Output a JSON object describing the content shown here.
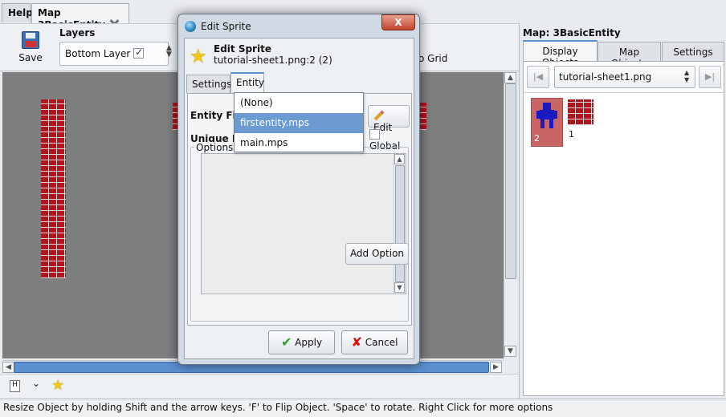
{
  "top_tabs": [
    {
      "label": "Help"
    },
    {
      "label": "Map 3BasicEntity"
    }
  ],
  "toolbar": {
    "save_label": "Save",
    "layers_group_label": "Layers",
    "layer_name": "Bottom Layer",
    "layer_visible": true,
    "snap_label_fragment": "o Grid"
  },
  "right_panel": {
    "title": "Map: 3BasicEntity",
    "tabs": [
      {
        "label": "Display Objects",
        "active": true
      },
      {
        "label": "Map Objects",
        "active": false
      },
      {
        "label": "Settings",
        "active": false
      }
    ],
    "sheet_select": "tutorial-sheet1.png",
    "objects": [
      {
        "label": "2",
        "kind": "entity-sprite",
        "selected": true
      },
      {
        "label": "1",
        "kind": "brick-tile",
        "selected": false
      }
    ]
  },
  "dialog": {
    "window_title": "Edit Sprite",
    "close_label": "X",
    "heading": "Edit Sprite",
    "subheading": "tutorial-sheet1.png:2 (2)",
    "tabs": [
      {
        "label": "Settings",
        "active": false
      },
      {
        "label": "Entity",
        "active": true
      }
    ],
    "entity_file_label": "Entity File:",
    "edit_button": "Edit",
    "unique_id_label": "Unique ID:",
    "global_label": "Global",
    "global_checked": false,
    "options_label": "Options",
    "add_option_button": "Add Option",
    "apply_button": "Apply",
    "cancel_button": "Cancel"
  },
  "entity_dropdown": {
    "items": [
      {
        "label": "(None)",
        "highlighted": false
      },
      {
        "label": "firstentity.mps",
        "highlighted": true
      },
      {
        "label": "main.mps",
        "highlighted": false
      }
    ]
  },
  "status_bar": "Resize Object by holding Shift and the arrow keys. 'F' to Flip Object. 'Space' to rotate. Right Click for more options",
  "colors": {
    "canvas_bg": "#7e7e7e",
    "brick": "#b5121b",
    "selection_highlight": "#6c9bd2",
    "accent_tab": "#5b8fcf"
  }
}
